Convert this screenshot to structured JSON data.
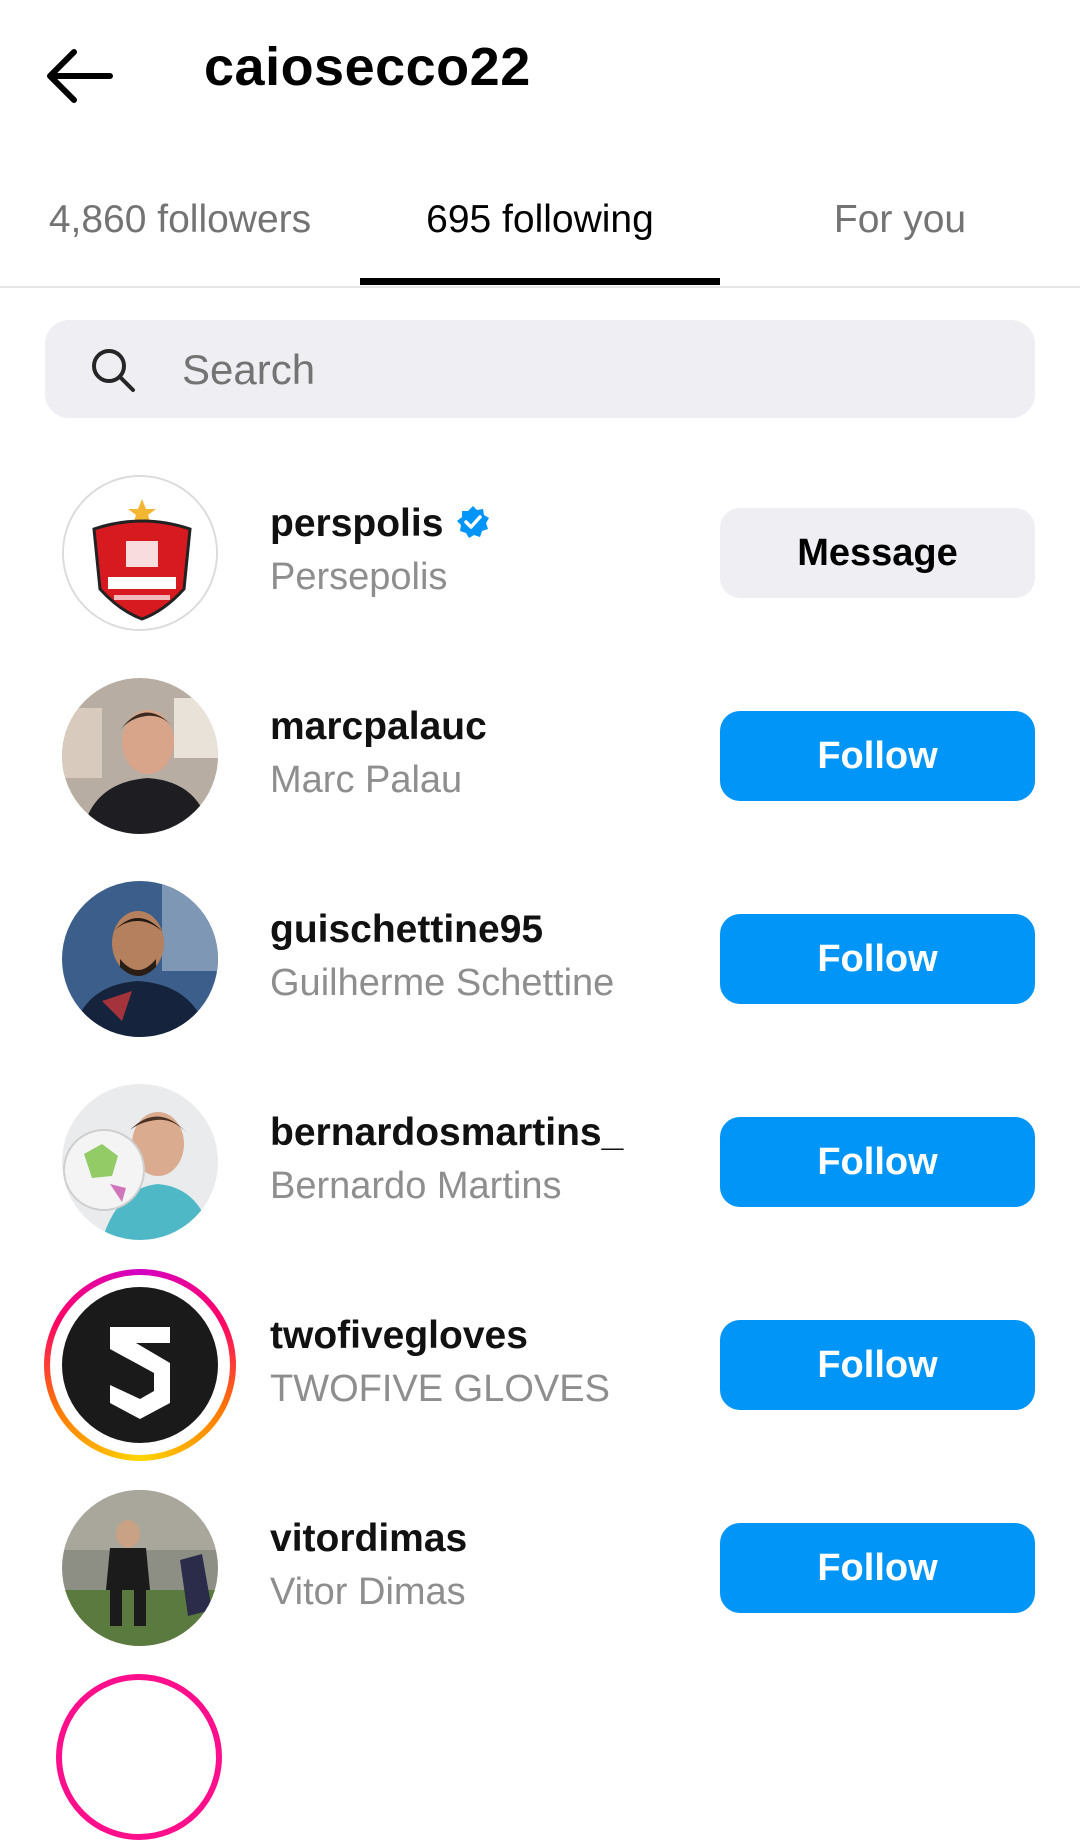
{
  "header": {
    "title": "caiosecco22",
    "back_icon": "arrow-left-icon"
  },
  "tabs": [
    {
      "label": "4,860 followers",
      "active": false
    },
    {
      "label": "695 following",
      "active": true
    },
    {
      "label": "For you",
      "active": false
    }
  ],
  "search": {
    "placeholder": "Search",
    "value": "",
    "icon": "search-icon"
  },
  "colors": {
    "follow_blue": "#0095f6",
    "verified_blue": "#0095f6",
    "secondary_text": "#8e8e8e",
    "message_bg": "#efeff3"
  },
  "accounts": [
    {
      "username": "perspolis",
      "full_name": "Persepolis",
      "verified": true,
      "button": "Message"
    },
    {
      "username": "marcpalauc",
      "full_name": "Marc Palau",
      "verified": false,
      "button": "Follow"
    },
    {
      "username": "guischettine95",
      "full_name": "Guilherme Schettine",
      "verified": false,
      "button": "Follow"
    },
    {
      "username": "bernardosmartins_",
      "full_name": "Bernardo Martins",
      "verified": false,
      "button": "Follow"
    },
    {
      "username": "twofivegloves",
      "full_name": "TWOFIVE GLOVES",
      "verified": false,
      "button": "Follow",
      "has_story": true
    },
    {
      "username": "vitordimas",
      "full_name": "Vitor Dimas",
      "verified": false,
      "button": "Follow"
    }
  ]
}
